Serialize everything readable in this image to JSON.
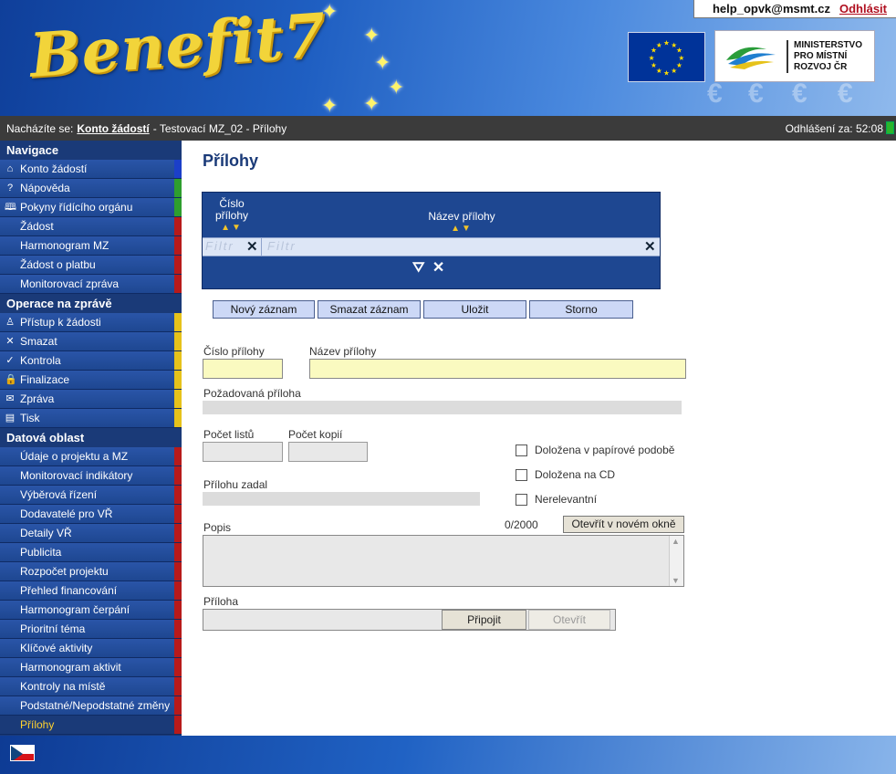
{
  "header": {
    "app_logo": "Benefit7",
    "user_email": "help_opvk@msmt.cz",
    "logout_label": "Odhlásit",
    "ministry_lines": [
      "MINISTERSTVO",
      "PRO MÍSTNÍ",
      "ROZVOJ ČR"
    ]
  },
  "location": {
    "prefix": "Nacházíte se:",
    "link": "Konto žádostí",
    "rest": "- Testovací MZ_02 - Přílohy",
    "session_label": "Odhlášení za: 52:08"
  },
  "sidebar": {
    "sections": [
      {
        "title": "Navigace",
        "items": [
          {
            "label": "Konto žádostí",
            "icon": "home-icon",
            "glyph": "⌂",
            "color": "#1b3fc9"
          },
          {
            "label": "Nápověda",
            "icon": "help-icon",
            "glyph": "?",
            "color": "#2e9e2e"
          },
          {
            "label": "Pokyny řídícího orgánu",
            "icon": "book-icon",
            "glyph": "🕮",
            "color": "#2e9e2e"
          },
          {
            "label": "Žádost",
            "icon": "",
            "glyph": "",
            "color": "#b81a1a"
          },
          {
            "label": "Harmonogram MZ",
            "icon": "",
            "glyph": "",
            "color": "#b81a1a"
          },
          {
            "label": "Žádost o platbu",
            "icon": "",
            "glyph": "",
            "color": "#b81a1a"
          },
          {
            "label": "Monitorovací zpráva",
            "icon": "",
            "glyph": "",
            "color": "#b81a1a"
          }
        ]
      },
      {
        "title": "Operace na zprávě",
        "items": [
          {
            "label": "Přístup k žádosti",
            "icon": "user-icon",
            "glyph": "♙",
            "color": "#e6c21a"
          },
          {
            "label": "Smazat",
            "icon": "delete-icon",
            "glyph": "✕",
            "color": "#e6c21a"
          },
          {
            "label": "Kontrola",
            "icon": "check-icon",
            "glyph": "✓",
            "color": "#e6c21a"
          },
          {
            "label": "Finalizace",
            "icon": "lock-icon",
            "glyph": "🔒",
            "color": "#e6c21a"
          },
          {
            "label": "Zpráva",
            "icon": "mail-icon",
            "glyph": "✉",
            "color": "#e6c21a"
          },
          {
            "label": "Tisk",
            "icon": "print-icon",
            "glyph": "▤",
            "color": "#e6c21a"
          }
        ]
      },
      {
        "title": "Datová oblast",
        "items": [
          {
            "label": "Údaje o projektu a MZ",
            "icon": "",
            "glyph": "",
            "color": "#b81a1a"
          },
          {
            "label": "Monitorovací indikátory",
            "icon": "",
            "glyph": "",
            "color": "#b81a1a"
          },
          {
            "label": "Výběrová řízení",
            "icon": "",
            "glyph": "",
            "color": "#b81a1a"
          },
          {
            "label": "Dodavatelé pro VŘ",
            "icon": "",
            "glyph": "",
            "color": "#b81a1a"
          },
          {
            "label": "Detaily VŘ",
            "icon": "",
            "glyph": "",
            "color": "#b81a1a"
          },
          {
            "label": "Publicita",
            "icon": "",
            "glyph": "",
            "color": "#b81a1a"
          },
          {
            "label": "Rozpočet projektu",
            "icon": "",
            "glyph": "",
            "color": "#b81a1a"
          },
          {
            "label": "Přehled financování",
            "icon": "",
            "glyph": "",
            "color": "#b81a1a"
          },
          {
            "label": "Harmonogram čerpání",
            "icon": "",
            "glyph": "",
            "color": "#b81a1a"
          },
          {
            "label": "Prioritní téma",
            "icon": "",
            "glyph": "",
            "color": "#b81a1a"
          },
          {
            "label": "Klíčové aktivity",
            "icon": "",
            "glyph": "",
            "color": "#b81a1a"
          },
          {
            "label": "Harmonogram aktivit",
            "icon": "",
            "glyph": "",
            "color": "#b81a1a"
          },
          {
            "label": "Kontroly na místě",
            "icon": "",
            "glyph": "",
            "color": "#b81a1a"
          },
          {
            "label": "Podstatné/Nepodstatné změny",
            "icon": "",
            "glyph": "",
            "color": "#b81a1a"
          },
          {
            "label": "Přílohy",
            "icon": "",
            "glyph": "",
            "color": "#b81a1a",
            "active": true
          }
        ]
      }
    ]
  },
  "main": {
    "title": "Přílohy",
    "grid": {
      "col1_line1": "Číslo",
      "col1_line2": "přílohy",
      "col2": "Název přílohy",
      "sort_glyph": "▲▼",
      "filter_placeholder_short": "Filtr",
      "filter_placeholder": "Filtr",
      "filter_glyph": "⛛",
      "clear_glyph": "✕"
    },
    "toolbar": {
      "new": "Nový záznam",
      "delete": "Smazat záznam",
      "save": "Uložit",
      "cancel": "Storno"
    },
    "form": {
      "cislo_label": "Číslo přílohy",
      "nazev_label": "Název přílohy",
      "pozadovana_label": "Požadovaná příloha",
      "listu_label": "Počet listů",
      "kopii_label": "Počet kopií",
      "zadal_label": "Přílohu zadal",
      "papir_label": "Doložena v papírové podobě",
      "cd_label": "Doložena na CD",
      "nerelevantni_label": "Nerelevantní",
      "popis_label": "Popis",
      "popis_counter": "0/2000",
      "open_window_label": "Otevřít v novém okně",
      "priloha_label": "Příloha",
      "attach_label": "Připojit",
      "open_label": "Otevřít"
    }
  },
  "footer": {
    "language_flag": "czech-flag-icon"
  }
}
